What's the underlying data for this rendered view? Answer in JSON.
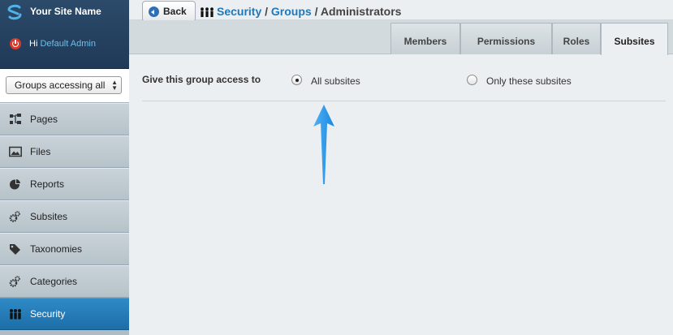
{
  "app": {
    "site_name": "Your Site Name",
    "greeting": "Hi",
    "user_name": "Default Admin"
  },
  "sidebar": {
    "dropdown_value": "Groups accessing all",
    "items": [
      {
        "label": "Pages",
        "icon": "sitemap-icon"
      },
      {
        "label": "Files",
        "icon": "image-icon"
      },
      {
        "label": "Reports",
        "icon": "pie-chart-icon"
      },
      {
        "label": "Subsites",
        "icon": "gears-icon"
      },
      {
        "label": "Taxonomies",
        "icon": "tag-icon"
      },
      {
        "label": "Categories",
        "icon": "gears-icon"
      },
      {
        "label": "Security",
        "icon": "group-icon",
        "active": true
      }
    ]
  },
  "header": {
    "back_label": "Back",
    "breadcrumb": [
      "Security",
      "Groups",
      "Administrators"
    ],
    "separator": " / "
  },
  "tabs": [
    {
      "label": "Members"
    },
    {
      "label": "Permissions"
    },
    {
      "label": "Roles"
    },
    {
      "label": "Subsites",
      "active": true
    }
  ],
  "form": {
    "label": "Give this group access to",
    "options": [
      {
        "label": "All subsites",
        "checked": true
      },
      {
        "label": "Only these subsites",
        "checked": false
      }
    ]
  },
  "colors": {
    "sidebar_active": "#1f78b8",
    "link": "#1f78b8",
    "annotation_arrow": "#1e90e8"
  }
}
